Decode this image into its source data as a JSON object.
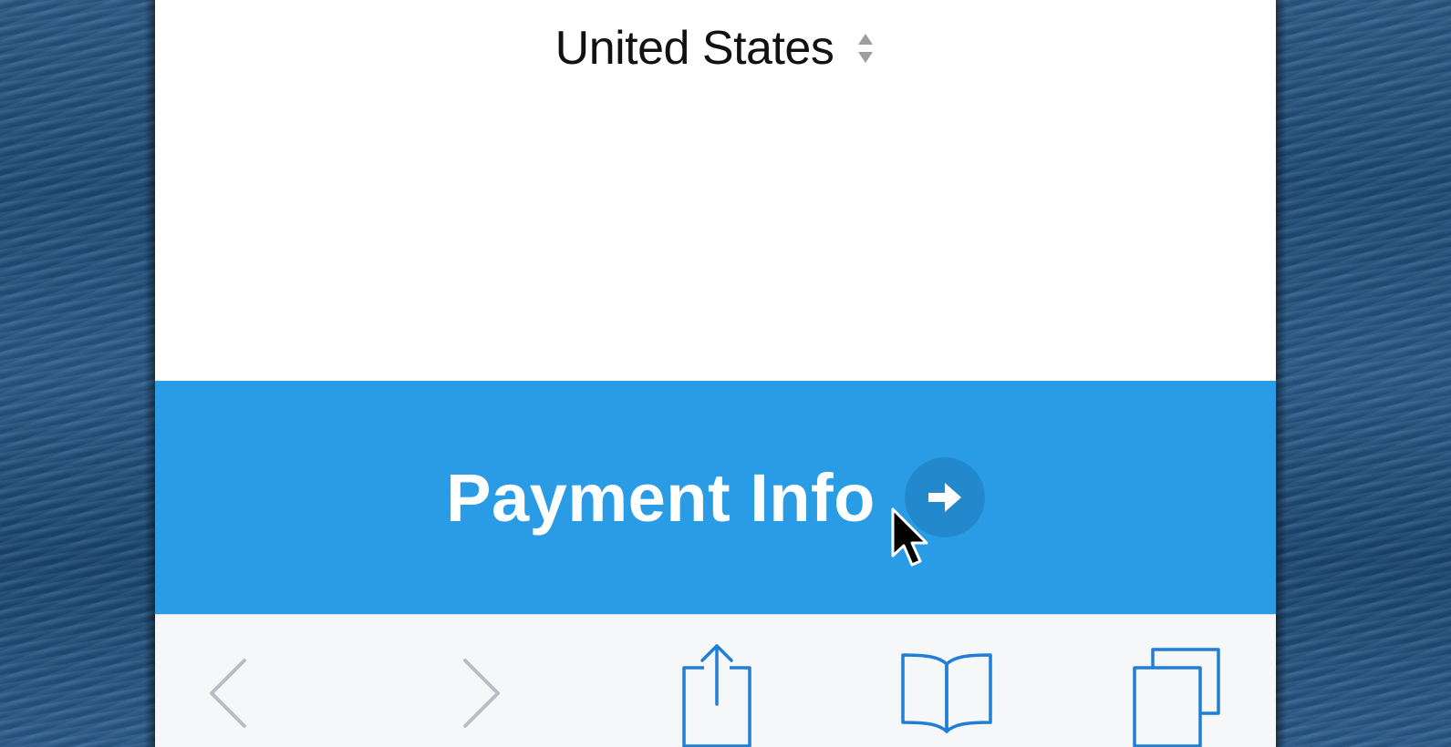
{
  "form": {
    "country_value": "United States"
  },
  "action_button": {
    "label": "Payment Info",
    "color": "#2a9ce6"
  },
  "toolbar": {
    "icons": [
      "back-icon",
      "forward-icon",
      "share-icon",
      "bookmarks-icon",
      "tabs-icon"
    ],
    "active_color": "#1f7fd6",
    "disabled_color": "#b9bcc2"
  }
}
